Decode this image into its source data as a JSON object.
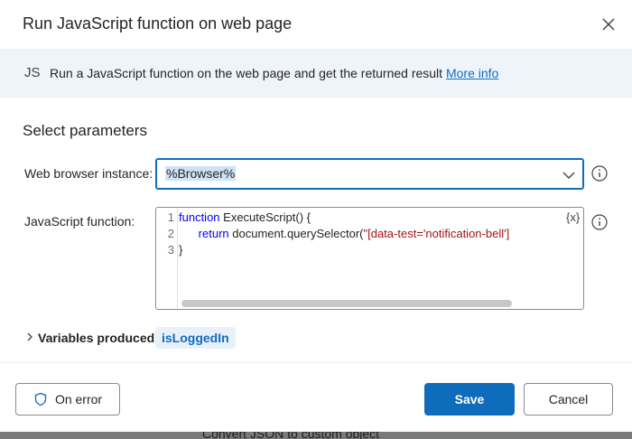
{
  "dialog": {
    "title": "Run JavaScript function on web page",
    "close_icon": "close-icon"
  },
  "info_bar": {
    "badge": "JS",
    "text": "Run a JavaScript function on the web page and get the returned result",
    "link": "More info"
  },
  "section": {
    "title": "Select parameters"
  },
  "fields": {
    "browser_label": "Web browser instance:",
    "browser_value": "%Browser%",
    "js_label": "JavaScript function:"
  },
  "code": {
    "lines": [
      {
        "num": "1",
        "keyword": "function",
        "rest": " ExecuteScript() {"
      },
      {
        "num": "2",
        "keyword": "return",
        "rest": " document.querySelector(",
        "string": "\"[data-test='notification-bell']"
      },
      {
        "num": "3",
        "rest": "}"
      }
    ],
    "variable_button": "{x}"
  },
  "variables": {
    "label": "Variables produced",
    "chip": "isLoggedIn"
  },
  "footer": {
    "on_error": "On error",
    "save": "Save",
    "cancel": "Cancel"
  },
  "background": {
    "partial_text": "Convert JSON to custom object"
  },
  "colors": {
    "accent": "#0f6cbd",
    "info_bar_bg": "#eff4fa",
    "keyword": "#0000ff",
    "string": "#a31515"
  }
}
